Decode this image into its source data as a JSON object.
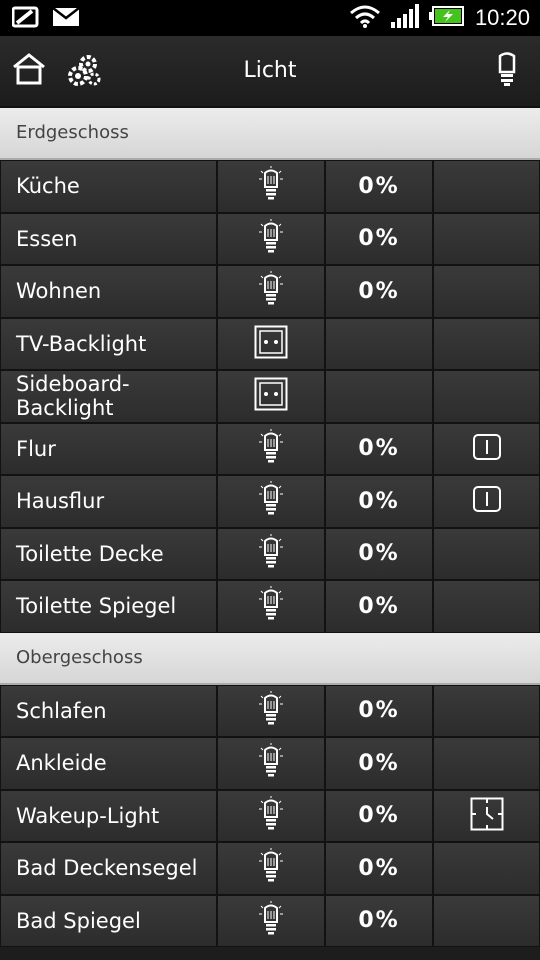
{
  "statusbar": {
    "time": "10:20",
    "icons": [
      "phone-icon",
      "mail-icon",
      "wifi-icon",
      "signal-icon",
      "battery-icon"
    ]
  },
  "actionbar": {
    "title": "Licht",
    "icons": [
      "home-icon",
      "settings-icon",
      "bulb-icon"
    ]
  },
  "sections": [
    {
      "name": "Erdgeschoss",
      "rows": [
        {
          "name": "Küche",
          "icon": "bulb-icon",
          "value": "0%",
          "action": ""
        },
        {
          "name": "Essen",
          "icon": "bulb-icon",
          "value": "0%",
          "action": ""
        },
        {
          "name": "Wohnen",
          "icon": "bulb-icon",
          "value": "0%",
          "action": ""
        },
        {
          "name": "TV-Backlight",
          "icon": "socket-icon",
          "value": "",
          "action": ""
        },
        {
          "name": "Sideboard-Backlight",
          "icon": "socket-icon",
          "value": "",
          "action": ""
        },
        {
          "name": "Flur",
          "icon": "bulb-icon",
          "value": "0%",
          "action": "switch-icon"
        },
        {
          "name": "Hausflur",
          "icon": "bulb-icon",
          "value": "0%",
          "action": "switch-icon"
        },
        {
          "name": "Toilette Decke",
          "icon": "bulb-icon",
          "value": "0%",
          "action": ""
        },
        {
          "name": "Toilette Spiegel",
          "icon": "bulb-icon",
          "value": "0%",
          "action": ""
        }
      ]
    },
    {
      "name": "Obergeschoss",
      "rows": [
        {
          "name": "Schlafen",
          "icon": "bulb-icon",
          "value": "0%",
          "action": ""
        },
        {
          "name": "Ankleide",
          "icon": "bulb-icon",
          "value": "0%",
          "action": ""
        },
        {
          "name": "Wakeup-Light",
          "icon": "bulb-icon",
          "value": "0%",
          "action": "timer-icon"
        },
        {
          "name": "Bad Deckensegel",
          "icon": "bulb-icon",
          "value": "0%",
          "action": ""
        },
        {
          "name": "Bad Spiegel",
          "icon": "bulb-icon",
          "value": "0%",
          "action": ""
        }
      ]
    }
  ]
}
